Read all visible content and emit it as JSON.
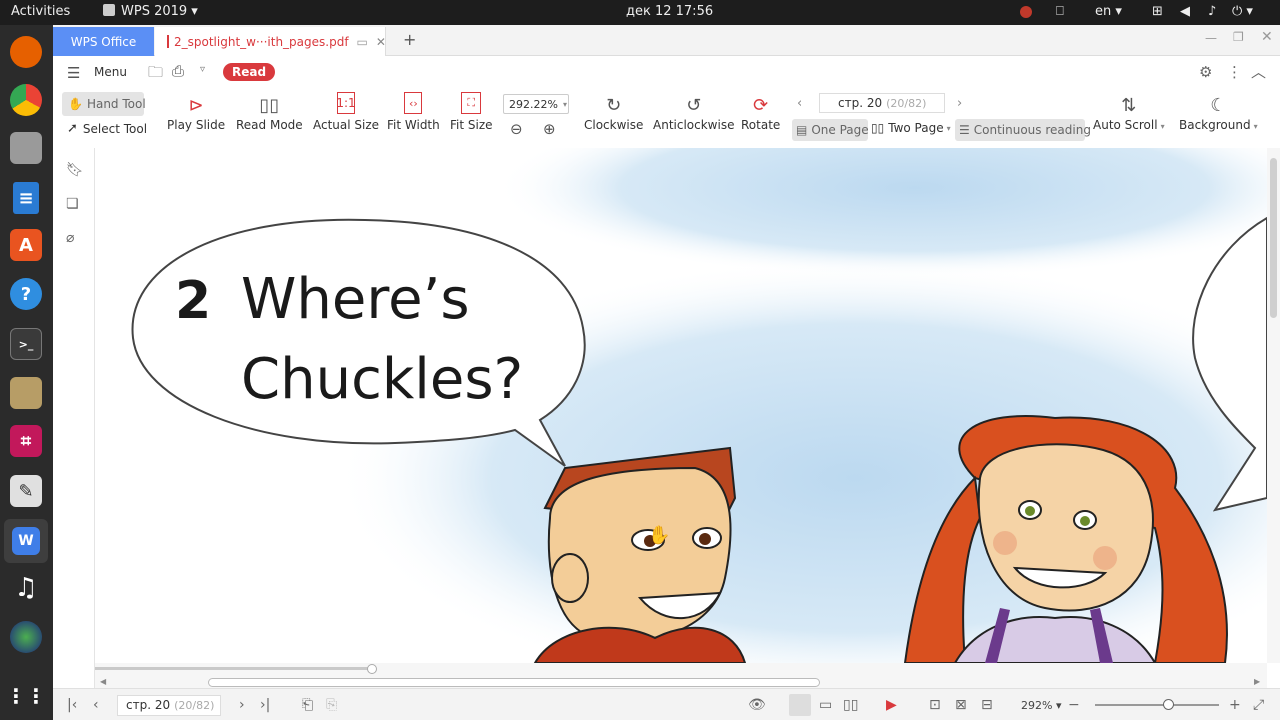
{
  "topbar": {
    "activities": "Activities",
    "app_name": "WPS 2019",
    "clock": "дек 12  17:56",
    "lang": "en"
  },
  "tabs": {
    "home": "WPS Office",
    "doc": "2_spotlight_w···ith_pages.pdf",
    "add": "+"
  },
  "menubar": {
    "menu": "Menu",
    "read": "Read"
  },
  "toolbar": {
    "hand_tool": "Hand Tool",
    "select_tool": "Select Tool",
    "play_slide": "Play Slide",
    "read_mode": "Read Mode",
    "actual_size": "Actual Size",
    "fit_width": "Fit Width",
    "fit_size": "Fit Size",
    "zoom_value": "292.22%",
    "clockwise": "Clockwise",
    "anticlockwise": "Anticlockwise",
    "rotate": "Rotate",
    "page_field": "стр. 20",
    "page_count": "(20/82)",
    "one_page": "One Page",
    "two_page": "Two Page",
    "continuous": "Continuous reading",
    "auto_scroll": "Auto Scroll",
    "background": "Background"
  },
  "document": {
    "number": "2",
    "title_line1": "Where’s",
    "title_line2": "Chuckles?"
  },
  "statusbar": {
    "page_field": "стр. 20",
    "page_count": "(20/82)",
    "zoom": "292%"
  },
  "colors": {
    "accent": "#5b8ff5",
    "read_badge": "#d9393d",
    "sky": "#cfe4f5"
  }
}
